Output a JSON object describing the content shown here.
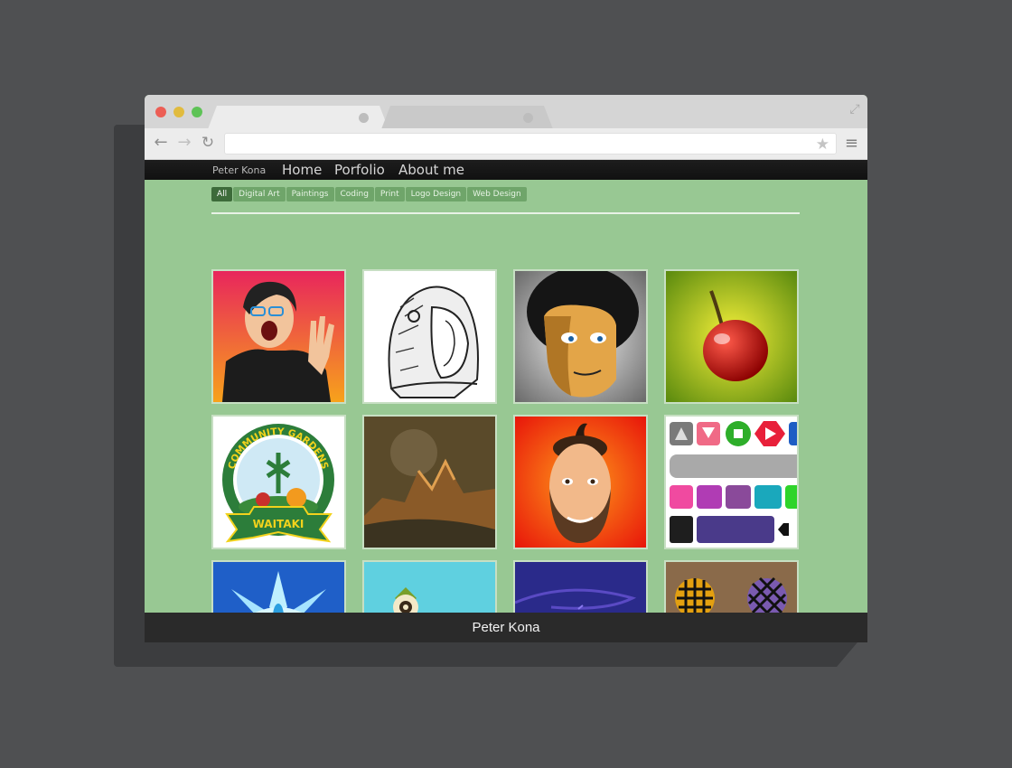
{
  "site": {
    "brand": "Peter Kona",
    "nav": [
      "Home",
      "Porfolio",
      "About me"
    ],
    "filters": [
      "All",
      "Digital Art",
      "Paintings",
      "Coding",
      "Print",
      "Logo Design",
      "Web Design"
    ],
    "active_filter": "All",
    "footer": "Peter Kona"
  },
  "browser": {
    "url": "",
    "traffic_lights": [
      "#ec5e55",
      "#e1bb3e",
      "#5ec356"
    ]
  },
  "colors": {
    "page_bg": "#98c893",
    "nav_bg": "#151515",
    "filter_bg": "#6fa56a",
    "filter_active_bg": "#3d6b3a",
    "footer_bg": "#2a2a2a"
  },
  "gallery": [
    {
      "subject": "screaming-man-portrait"
    },
    {
      "subject": "astronaut-sketch"
    },
    {
      "subject": "afro-man-cartoon"
    },
    {
      "subject": "red-cherry"
    },
    {
      "subject": "community-gardens-logo",
      "text_top": "COMMUNITY GARDENS",
      "text_bottom": "WAITAKI"
    },
    {
      "subject": "landscape-painting"
    },
    {
      "subject": "topknot-man-cartoon"
    },
    {
      "subject": "ui-buttons-kit"
    },
    {
      "subject": "blue-lotus"
    },
    {
      "subject": "teal-geometric"
    },
    {
      "subject": "purple-swirl"
    },
    {
      "subject": "wire-spheres"
    }
  ]
}
